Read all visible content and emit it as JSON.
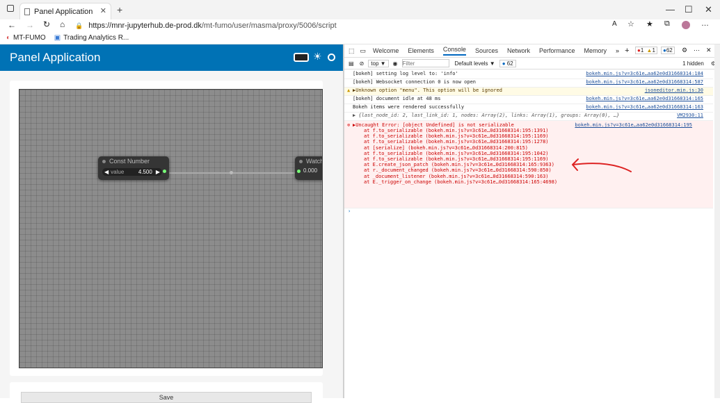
{
  "browser": {
    "tab_title": "Panel Application",
    "url_host": "https://mnr-jupyterhub.de-prod.dk",
    "url_path": "/mt-fumo/user/masma/proxy/5006/script",
    "bookmarks": [
      "MT-FUMO",
      "Trading Analytics R..."
    ]
  },
  "panel": {
    "title": "Panel Application",
    "save_label": "Save",
    "const_node": {
      "title": "Const Number",
      "field": "value",
      "value": "4.500"
    },
    "watch_node": {
      "title": "Watch",
      "value": "0.000"
    }
  },
  "devtools": {
    "tabs": [
      "Welcome",
      "Elements",
      "Console",
      "Sources",
      "Network",
      "Performance",
      "Memory"
    ],
    "active_tab": "Console",
    "error_count": "1",
    "warning_count": "1",
    "message_count": "62",
    "context": "top",
    "filter_placeholder": "Filter",
    "levels": "Default levels",
    "issues_count": "62",
    "hidden": "1 hidden",
    "logs": [
      {
        "text": "[bokeh] setting log level to: 'info'",
        "src": "bokeh.min.js?v=3c61e…aa62e0d31668314:184"
      },
      {
        "text": "[bokeh] Websocket connection 0 is now open",
        "src": "bokeh.min.js?v=3c61e…aa62e0d31668314:587"
      },
      {
        "text": "▶Unknown option \"menu\". This option will be ignored",
        "src": "jsoneditor.min.js:30"
      },
      {
        "text": "[bokeh] document idle at 48 ms",
        "src": "bokeh.min.js?v=3c61e…aa62e0d31668314:165"
      },
      {
        "text": "Bokeh items were rendered successfully",
        "src": "bokeh.min.js?v=3c61e…aa62e0d31668314:163"
      },
      {
        "text": "▶ {last_node_id: 2, last_link_id: 1, nodes: Array(2), links: Array(1), groups: Array(0), …}",
        "src": "VM2930:11"
      }
    ],
    "error": {
      "head": "▶Uncaught Error: [object Undefined] is not serializable",
      "src": "bokeh.min.js?v=3c61e…aa62e0d31668314:195",
      "stack": [
        "at f.to_serializable (bokeh.min.js?v=3c61e…0d31668314:195:1391)",
        "at f.to_serializable (bokeh.min.js?v=3c61e…0d31668314:195:1169)",
        "at f.to_serializable (bokeh.min.js?v=3c61e…0d31668314:195:1278)",
        "at [serialize] (bokeh.min.js?v=3c61e…0d31668314:200:815)",
        "at f.to_serializable (bokeh.min.js?v=3c61e…0d31668314:195:1042)",
        "at f.to_serializable (bokeh.min.js?v=3c61e…0d31668314:195:1169)",
        "at E.create_json_patch (bokeh.min.js?v=3c61e…0d31668314:165:9363)",
        "at r._document_changed (bokeh.min.js?v=3c61e…0d31668314:590:850)",
        "at _document_listener (bokeh.min.js?v=3c61e…0d31668314:590:163)",
        "at E._trigger_on_change (bokeh.min.js?v=3c61e…0d31668314:165:4698)"
      ]
    },
    "prompt": "›"
  }
}
